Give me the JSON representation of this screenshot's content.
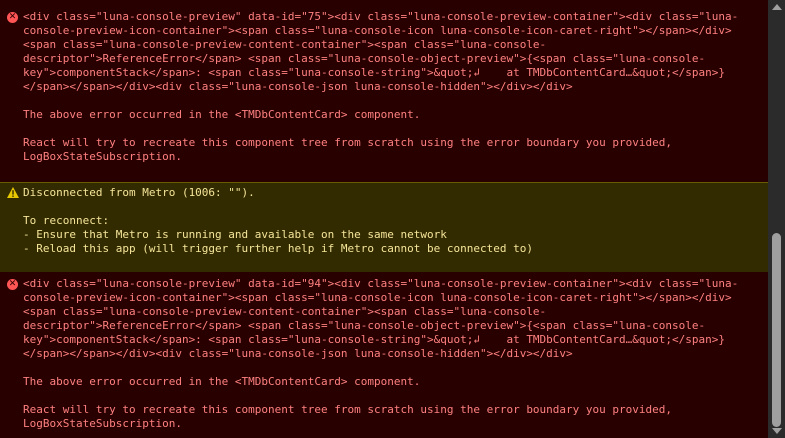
{
  "messages": [
    {
      "type": "error",
      "lines": [
        "<div class=\"luna-console-preview\" data-id=\"75\"><div class=\"luna-console-preview-container\"><div class=\"luna-",
        "console-preview-icon-container\"><span class=\"luna-console-icon luna-console-icon-caret-right\"></span></div>",
        "<span class=\"luna-console-preview-content-container\"><span class=\"luna-console-",
        "descriptor\">ReferenceError</span> <span class=\"luna-console-object-preview\">{<span class=\"luna-console-",
        "key\">componentStack</span>: <span class=\"luna-console-string\">&quot;↲    at TMDbContentCard…&quot;</span>}",
        "</span></span></div><div class=\"luna-console-json luna-console-hidden\"></div></div>",
        "",
        "The above error occurred in the <TMDbContentCard> component.",
        "",
        "React will try to recreate this component tree from scratch using the error boundary you provided,",
        "LogBoxStateSubscription."
      ]
    },
    {
      "type": "warning",
      "lines": [
        "Disconnected from Metro (1006: \"\").",
        "",
        "To reconnect:",
        "- Ensure that Metro is running and available on the same network",
        "- Reload this app (will trigger further help if Metro cannot be connected to)"
      ]
    },
    {
      "type": "error",
      "lines": [
        "<div class=\"luna-console-preview\" data-id=\"94\"><div class=\"luna-console-preview-container\"><div class=\"luna-",
        "console-preview-icon-container\"><span class=\"luna-console-icon luna-console-icon-caret-right\"></span></div>",
        "<span class=\"luna-console-preview-content-container\"><span class=\"luna-console-",
        "descriptor\">ReferenceError</span> <span class=\"luna-console-object-preview\">{<span class=\"luna-console-",
        "key\">componentStack</span>: <span class=\"luna-console-string\">&quot;↲    at TMDbContentCard…&quot;</span>}",
        "</span></span></div><div class=\"luna-console-json luna-console-hidden\"></div></div>",
        "",
        "The above error occurred in the <TMDbContentCard> component.",
        "",
        "React will try to recreate this component tree from scratch using the error boundary you provided,",
        "LogBoxStateSubscription."
      ]
    }
  ],
  "icons": {
    "error": "error-x-icon",
    "warning": "warning-triangle-icon"
  },
  "colors": {
    "error_bg": "#290000",
    "error_text": "#fe8080",
    "warning_bg": "#332b00",
    "warning_text": "#f5e59a"
  }
}
